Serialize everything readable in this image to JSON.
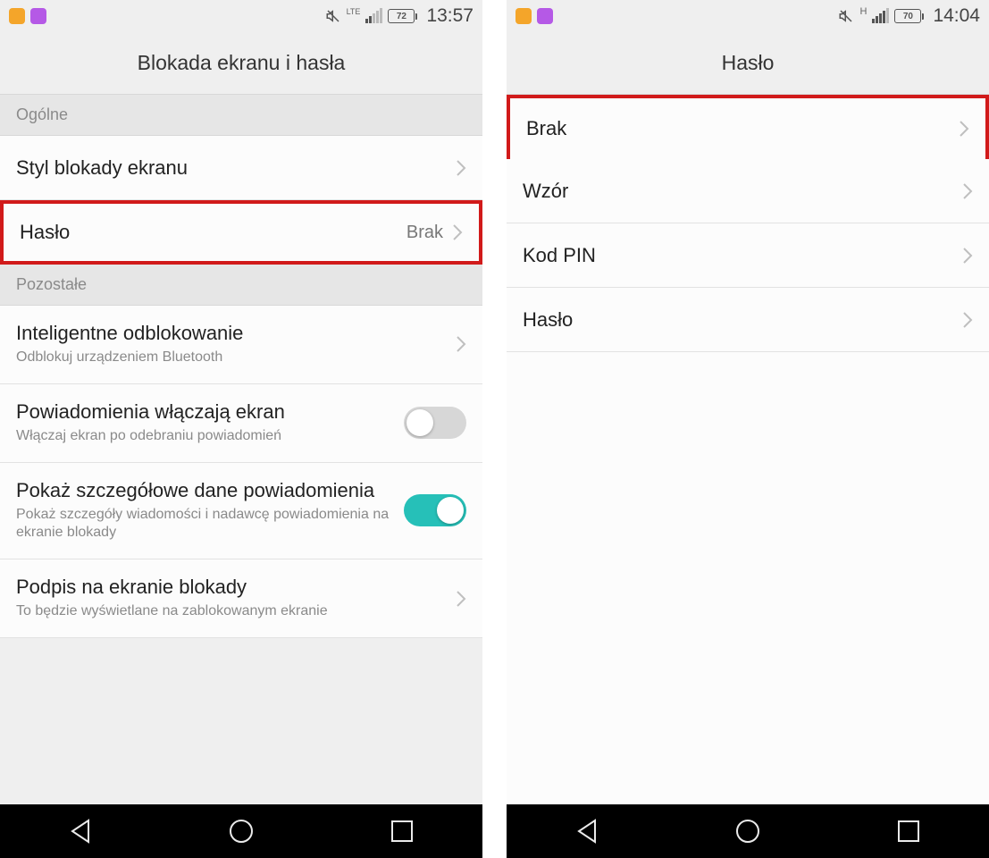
{
  "phone1": {
    "status": {
      "network_label": "LTE",
      "battery": "72",
      "time": "13:57"
    },
    "header_title": "Blokada ekranu i hasła",
    "section_general": "Ogólne",
    "item_lock_style": {
      "title": "Styl blokady ekranu"
    },
    "item_password": {
      "title": "Hasło",
      "value": "Brak"
    },
    "section_other": "Pozostałe",
    "item_smart_unlock": {
      "title": "Inteligentne odblokowanie",
      "subtitle": "Odblokuj urządzeniem Bluetooth"
    },
    "item_notif_wake": {
      "title": "Powiadomienia włączają ekran",
      "subtitle": "Włączaj ekran po odebraniu powiadomień"
    },
    "item_notif_details": {
      "title": "Pokaż szczegółowe dane powiadomienia",
      "subtitle": "Pokaż szczegóły wiadomości i nadawcę powiadomienia na ekranie blokady"
    },
    "item_lock_signature": {
      "title": "Podpis na ekranie blokady",
      "subtitle": "To będzie wyświetlane na zablokowanym ekranie"
    }
  },
  "phone2": {
    "status": {
      "network_label": "H",
      "battery": "70",
      "time": "14:04"
    },
    "header_title": "Hasło",
    "items": {
      "none": "Brak",
      "pattern": "Wzór",
      "pin": "Kod PIN",
      "password": "Hasło"
    }
  }
}
